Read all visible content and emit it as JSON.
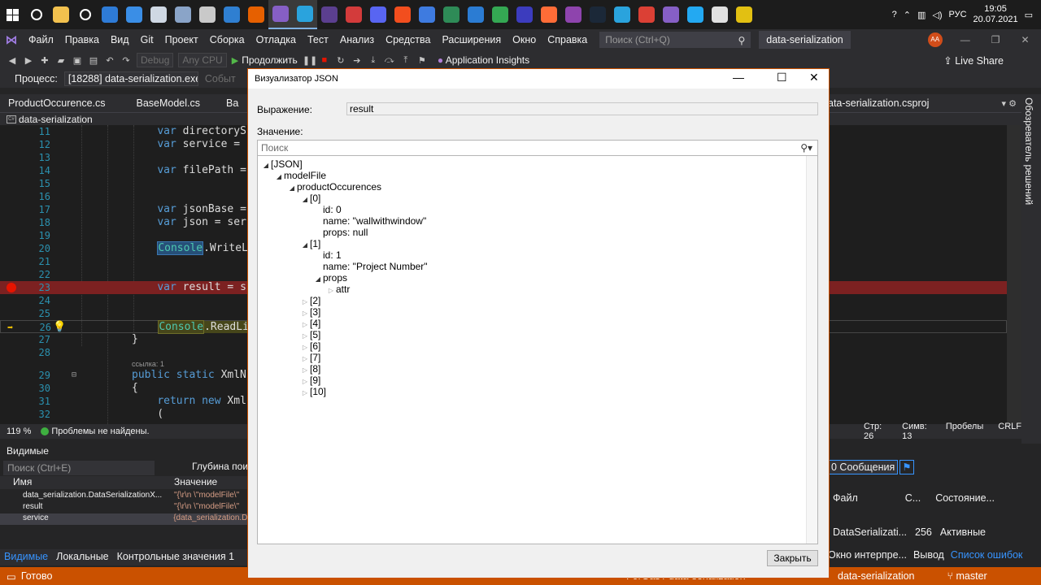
{
  "taskbar": {
    "icons": [
      {
        "name": "search-icon",
        "color": "#1c1c1c"
      },
      {
        "name": "folder-icon",
        "color": "#f2c14e"
      },
      {
        "name": "settings-icon",
        "color": "#1c1c1c"
      },
      {
        "name": "photos-icon",
        "color": "#2e7bd6"
      },
      {
        "name": "monitor-icon",
        "color": "#3a8ee6"
      },
      {
        "name": "store-icon",
        "color": "#cfd8e3"
      },
      {
        "name": "calculator-icon",
        "color": "#8aa4c8"
      },
      {
        "name": "paint-icon",
        "color": "#c9c9c9"
      },
      {
        "name": "mail-icon",
        "color": "#2f7fd1"
      },
      {
        "name": "firefox-icon",
        "color": "#e66000"
      },
      {
        "name": "visual-studio-icon",
        "color": "#865fc5"
      },
      {
        "name": "telegram-icon",
        "color": "#2aa3dd"
      },
      {
        "name": "terminal-icon",
        "color": "#5b3f8f"
      },
      {
        "name": "app-red-icon",
        "color": "#d33b3b"
      },
      {
        "name": "discord-icon",
        "color": "#5865f2"
      },
      {
        "name": "figma-icon",
        "color": "#f24e1e"
      },
      {
        "name": "firefox-dev-icon",
        "color": "#3e7be0"
      },
      {
        "name": "git-kraken-icon",
        "color": "#2e8b57"
      },
      {
        "name": "edge-icon",
        "color": "#2b7cd3"
      },
      {
        "name": "chrome-icon",
        "color": "#34a853"
      },
      {
        "name": "dp-icon",
        "color": "#3c3cbe"
      },
      {
        "name": "postman-icon",
        "color": "#ff6c37"
      },
      {
        "name": "podcast-icon",
        "color": "#8e44ad"
      },
      {
        "name": "steam-icon",
        "color": "#1b2838"
      },
      {
        "name": "telegram2-icon",
        "color": "#2aa3dd"
      },
      {
        "name": "todoist-icon",
        "color": "#db4035"
      },
      {
        "name": "vs-icon",
        "color": "#865fc5"
      },
      {
        "name": "vscode-icon",
        "color": "#23a9f2"
      },
      {
        "name": "github-icon",
        "color": "#e0e0e0"
      },
      {
        "name": "warning-app-icon",
        "color": "#e2c012"
      }
    ],
    "lang": "РУС",
    "time": "19:05",
    "date": "20.07.2021"
  },
  "menubar": {
    "items": [
      "Файл",
      "Правка",
      "Вид",
      "Git",
      "Проект",
      "Сборка",
      "Отладка",
      "Тест",
      "Анализ",
      "Средства",
      "Расширения",
      "Окно",
      "Справка"
    ],
    "search_placeholder": "Поиск (Ctrl+Q)",
    "solution_name": "data-serialization",
    "avatar_initials": "AA"
  },
  "toolbar": {
    "config": "Debug",
    "platform": "Any CPU",
    "continue_label": "Продолжить",
    "app_insights": "Application Insights",
    "live_share": "Live Share"
  },
  "procbar": {
    "label": "Процесс:",
    "process": "[18288] data-serialization.exe",
    "events": "Событ"
  },
  "tabs": {
    "items": [
      "ProductOccurence.cs",
      "BaseModel.cs",
      "Ba"
    ],
    "right": "ata-serialization.csproj"
  },
  "nav": {
    "project": "data-serialization"
  },
  "sidetab": {
    "label": "Обозреватель решений"
  },
  "editor": {
    "refs": "ссылка: 1"
  },
  "edstatus": {
    "zoom": "119 %",
    "problems": "Проблемы не найдены.",
    "line": "Стр: 26",
    "col": "Симв: 13",
    "spaces": "Пробелы",
    "eol": "CRLF"
  },
  "locals": {
    "title": "Видимые",
    "search_placeholder": "Поиск (Ctrl+E)",
    "depth": "Глубина пои",
    "col_name": "Имя",
    "col_value": "Значение",
    "rows": [
      {
        "name": "data_serialization.DataSerializationX...",
        "value": "\"{\\r\\n \\\"modelFile\\\""
      },
      {
        "name": "result",
        "value": "\"{\\r\\n \\\"modelFile\\\""
      },
      {
        "name": "service",
        "value": "{data_serialization.D"
      }
    ],
    "tabs": [
      "Видимые",
      "Локальные",
      "Контрольные значения 1"
    ]
  },
  "errors": {
    "messages": "0 Сообщения",
    "col_file": "Файл",
    "col_c": "С...",
    "col_state": "Состояние...",
    "row_file": "DataSerializati...",
    "row_c": "256",
    "row_state": "Активные",
    "tabs": [
      "Окно интерпре...",
      "Вывод",
      "Список ошибок"
    ]
  },
  "statusbar": {
    "ready": "Готово",
    "repo": "ForGas / data-serialization",
    "project": "data-serialization",
    "branch": "master"
  },
  "dialog": {
    "title": "Визуализатор JSON",
    "expr_label": "Выражение:",
    "expr_value": "result",
    "value_label": "Значение:",
    "search_placeholder": "Поиск",
    "close_label": "Закрыть",
    "tree": [
      {
        "text": "[JSON]",
        "depth": 0,
        "toggle": "open"
      },
      {
        "text": "modelFile",
        "depth": 1,
        "toggle": "open"
      },
      {
        "text": "productOccurences",
        "depth": 2,
        "toggle": "open"
      },
      {
        "text": "[0]",
        "depth": 3,
        "toggle": "open"
      },
      {
        "text": "id: 0",
        "depth": 4,
        "toggle": "none"
      },
      {
        "text": "name: \"wallwithwindow\"",
        "depth": 4,
        "toggle": "none"
      },
      {
        "text": "props: null",
        "depth": 4,
        "toggle": "none"
      },
      {
        "text": "[1]",
        "depth": 3,
        "toggle": "open"
      },
      {
        "text": "id: 1",
        "depth": 4,
        "toggle": "none"
      },
      {
        "text": "name: \"Project  Number\"",
        "depth": 4,
        "toggle": "none"
      },
      {
        "text": "props",
        "depth": 4,
        "toggle": "open"
      },
      {
        "text": "attr",
        "depth": 5,
        "toggle": "closed"
      },
      {
        "text": "[2]",
        "depth": 3,
        "toggle": "closed"
      },
      {
        "text": "[3]",
        "depth": 3,
        "toggle": "closed"
      },
      {
        "text": "[4]",
        "depth": 3,
        "toggle": "closed"
      },
      {
        "text": "[5]",
        "depth": 3,
        "toggle": "closed"
      },
      {
        "text": "[6]",
        "depth": 3,
        "toggle": "closed"
      },
      {
        "text": "[7]",
        "depth": 3,
        "toggle": "closed"
      },
      {
        "text": "[8]",
        "depth": 3,
        "toggle": "closed"
      },
      {
        "text": "[9]",
        "depth": 3,
        "toggle": "closed"
      },
      {
        "text": "[10]",
        "depth": 3,
        "toggle": "closed"
      }
    ]
  }
}
